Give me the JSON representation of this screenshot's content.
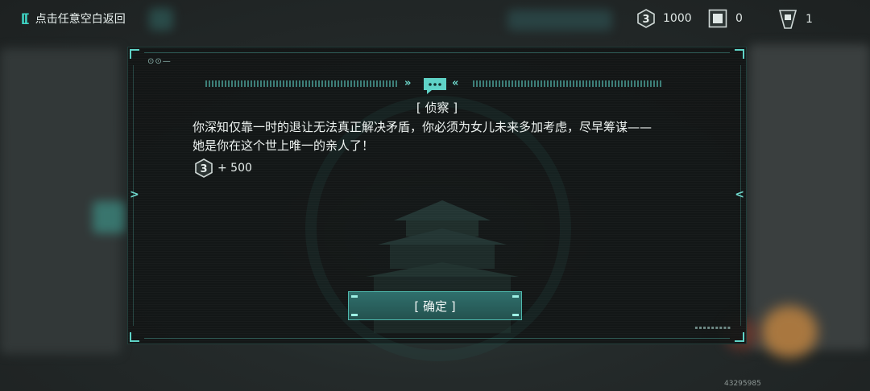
{
  "topbar": {
    "back_label": "点击任意空白返回",
    "resources": [
      {
        "icon": "hex-coin-icon",
        "value": "1000"
      },
      {
        "icon": "chip-icon",
        "value": "0"
      },
      {
        "icon": "badge-icon",
        "value": "1"
      }
    ]
  },
  "dialog": {
    "title": "[ 侦察 ]",
    "body_line1": "你深知仅靠一时的退让无法真正解决矛盾，你必须为女儿未来多加考虑，尽早筹谋——",
    "body_line2": "她是你在这个世上唯一的亲人了！",
    "reward_text": "+ 500",
    "reward_icon": "hex-coin-icon",
    "confirm_label": "[ 确定 ]"
  },
  "watermark": "43295985",
  "colors": {
    "accent": "#5fd3c7",
    "button": "#2f6f6c"
  }
}
